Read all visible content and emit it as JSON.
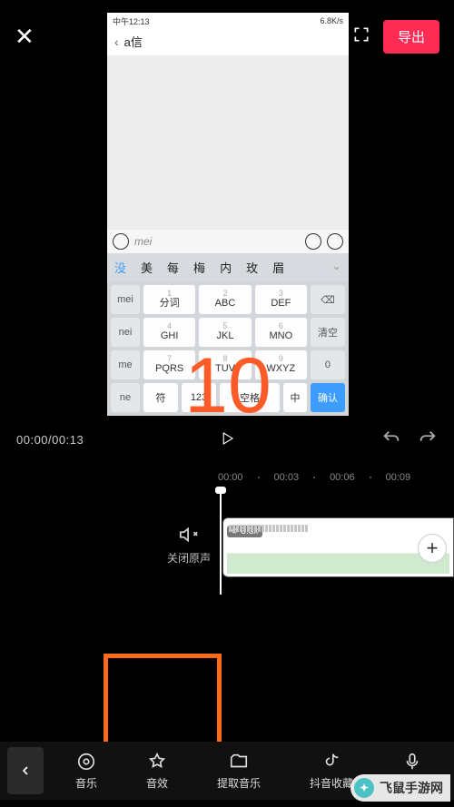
{
  "header": {
    "export_label": "导出"
  },
  "preview": {
    "status_left": "中午12:13",
    "status_right": "6.8K/s",
    "chat_title": "a信",
    "pinyin": "mei",
    "candidates": [
      "没",
      "美",
      "每",
      "梅",
      "内",
      "玫",
      "眉"
    ],
    "side_keys": [
      "mei",
      "nei",
      "me",
      "ne"
    ],
    "keypad": [
      [
        {
          "n": "1",
          "l": "分词"
        },
        {
          "n": "2",
          "l": "ABC"
        },
        {
          "n": "3",
          "l": "DEF"
        }
      ],
      [
        {
          "n": "4",
          "l": "GHI"
        },
        {
          "n": "5",
          "l": "JKL"
        },
        {
          "n": "6",
          "l": "MNO"
        }
      ],
      [
        {
          "n": "7",
          "l": "PQRS"
        },
        {
          "n": "8",
          "l": "TUV"
        },
        {
          "n": "9",
          "l": "WXYZ"
        }
      ]
    ],
    "end_keys": [
      "⌫",
      "清空",
      "0"
    ],
    "bottom_keys": {
      "sym": "符",
      "num": "123",
      "space": "空格",
      "cn": "中",
      "ok": "确认"
    },
    "overlay_num": "10"
  },
  "controls": {
    "time": "00:00/00:13"
  },
  "ruler": [
    "00:00",
    "00:03",
    "00:06",
    "00:09"
  ],
  "timeline": {
    "mute_label": "关闭原声",
    "speed_badge": "3.3x"
  },
  "tabs": [
    {
      "label": "音乐",
      "icon": "music"
    },
    {
      "label": "音效",
      "icon": "star"
    },
    {
      "label": "提取音乐",
      "icon": "folder"
    },
    {
      "label": "抖音收藏",
      "icon": "tiktok"
    },
    {
      "label": "",
      "icon": "mic"
    }
  ],
  "watermark": "飞鼠手游网"
}
